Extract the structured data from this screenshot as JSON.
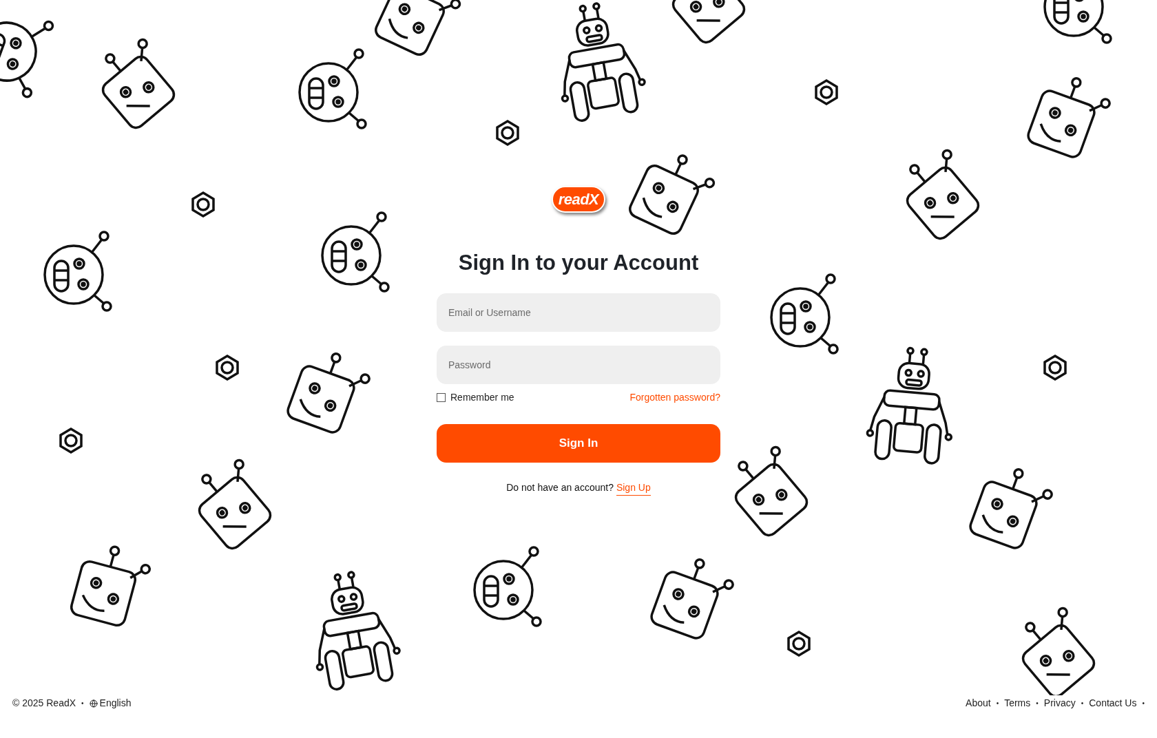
{
  "logo": {
    "text": "readX"
  },
  "title": "Sign In to your Account",
  "fields": [
    {
      "placeholder": "Email or Username"
    },
    {
      "placeholder": "Password"
    }
  ],
  "remember": {
    "label": "Remember me",
    "checked": false
  },
  "forgot_link": "Forgotten password?",
  "submit": "Sign In",
  "signup": {
    "prompt": "Do not have an account?",
    "link": "Sign Up"
  },
  "footer": {
    "copyright": "© 2025 ReadX",
    "separator": "•",
    "language": "English",
    "links": [
      "About",
      "Terms",
      "Privacy",
      "Contact Us"
    ]
  }
}
